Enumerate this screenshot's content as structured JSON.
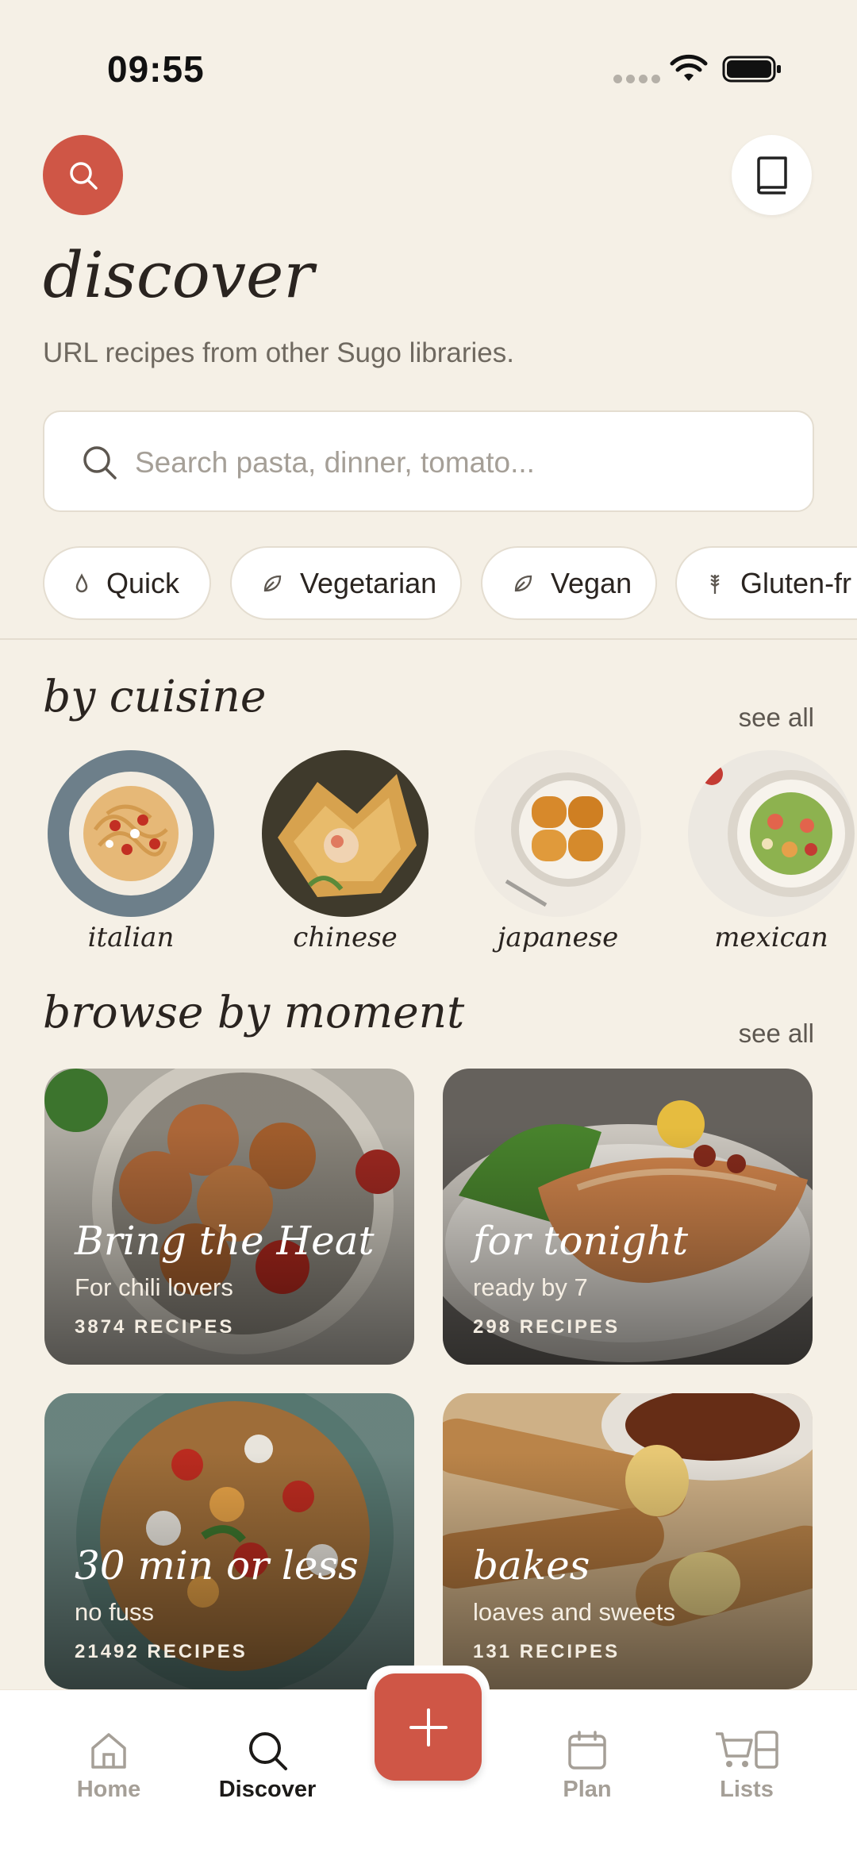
{
  "status": {
    "time": "09:55"
  },
  "header": {
    "title": "discover",
    "subtitle": "URL recipes from other Sugo libraries."
  },
  "search": {
    "placeholder": "Search pasta, dinner, tomato...",
    "value": ""
  },
  "filters": [
    {
      "label": "Quick",
      "icon": "drop-icon"
    },
    {
      "label": "Vegetarian",
      "icon": "leaf-icon"
    },
    {
      "label": "Vegan",
      "icon": "leaf-icon"
    },
    {
      "label": "Gluten-fr",
      "icon": "wheat-icon"
    }
  ],
  "cuisine": {
    "title": "by cuisine",
    "see_all": "see all",
    "items": [
      {
        "label": "italian"
      },
      {
        "label": "chinese"
      },
      {
        "label": "japanese"
      },
      {
        "label": "mexican"
      }
    ]
  },
  "moments": {
    "title": "browse by moment",
    "see_all": "see all",
    "cards": [
      {
        "title": "Bring the Heat",
        "subtitle": "For chili lovers",
        "count": "3874 RECIPES"
      },
      {
        "title": "for tonight",
        "subtitle": "ready by 7",
        "count": "298 RECIPES"
      },
      {
        "title": "30 min or less",
        "subtitle": "no fuss",
        "count": "21492 RECIPES"
      },
      {
        "title": "bakes",
        "subtitle": "loaves and sweets",
        "count": "131 RECIPES"
      }
    ]
  },
  "nav": {
    "home": "Home",
    "discover": "Discover",
    "plan": "Plan",
    "lists": "Lists",
    "active": "Discover"
  },
  "colors": {
    "accent": "#cf5646",
    "background": "#f5f0e6"
  }
}
